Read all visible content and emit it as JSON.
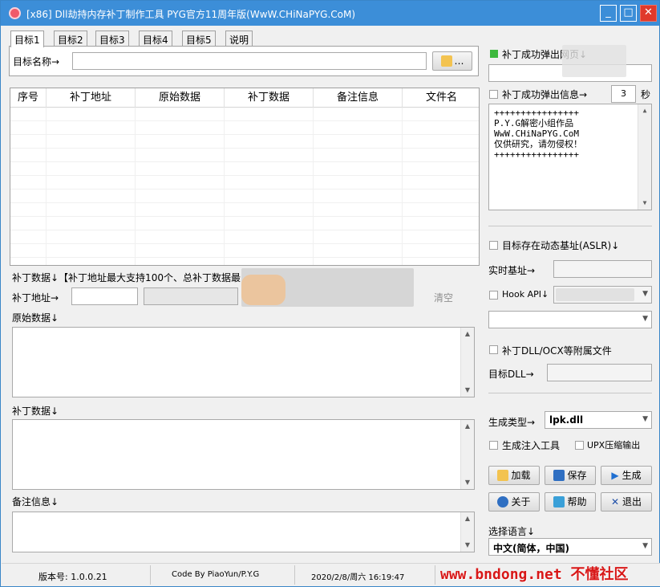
{
  "window": {
    "title": "[x86] Dll劫持内存补丁制作工具  PYG官方11周年版(WwW.CHiNaPYG.CoM)",
    "min": "_",
    "max": "□",
    "close": "✕"
  },
  "tabs": [
    "目标1",
    "目标2",
    "目标3",
    "目标4",
    "目标5",
    "说明"
  ],
  "target": {
    "name_label": "目标名称→",
    "name_value": "",
    "browse_label": "…"
  },
  "table": {
    "columns": [
      "序号",
      "补丁地址",
      "原始数据",
      "补丁数据",
      "备注信息",
      "文件名"
    ]
  },
  "patch": {
    "header": "补丁数据↓【补丁地址最大支持100个、总补丁数据最",
    "addr_label": "补丁地址→",
    "addr_value": "",
    "clear_label": "清空",
    "orig_label": "原始数据↓",
    "patch_label": "补丁数据↓",
    "note_label": "备注信息↓"
  },
  "right": {
    "popup_web_label": "补丁成功弹出网页↓",
    "popup_msg_label": "补丁成功弹出信息→",
    "popup_seconds": "3",
    "seconds_unit": "秒",
    "info_text": "++++++++++++++++\nP.Y.G解密小组作品\nWwW.CHiNaPYG.CoM\n仅供研究，请勿侵权！\n++++++++++++++++",
    "aslr_label": "目标存在动态基址(ASLR)↓",
    "realtime_label": "实时基址→",
    "hook_label": "Hook API↓",
    "dll_attach_label": "补丁DLL/OCX等附属文件",
    "target_dll_label": "目标DLL→",
    "gen_type_label": "生成类型→",
    "gen_type_value": "lpk.dll",
    "gen_injector_label": "生成注入工具",
    "upx_label": "UPX压缩输出",
    "load_label": "加载",
    "save_label": "保存",
    "generate_label": "生成",
    "about_label": "关于",
    "help_label": "帮助",
    "exit_label": "退出",
    "lang_label": "选择语言↓",
    "lang_value": "中文(简体，中国)"
  },
  "status": {
    "version": "版本号: 1.0.0.21",
    "code_by": "Code By PiaoYun/P.Y.G",
    "datetime": "2020/2/8/周六 16:19:47"
  },
  "watermark": "www.bndong.net 不懂社区",
  "colors": {
    "titlebar": "#3c8ed8",
    "close": "#e0392b",
    "green": "#3db83d",
    "watermark": "#d81818"
  }
}
